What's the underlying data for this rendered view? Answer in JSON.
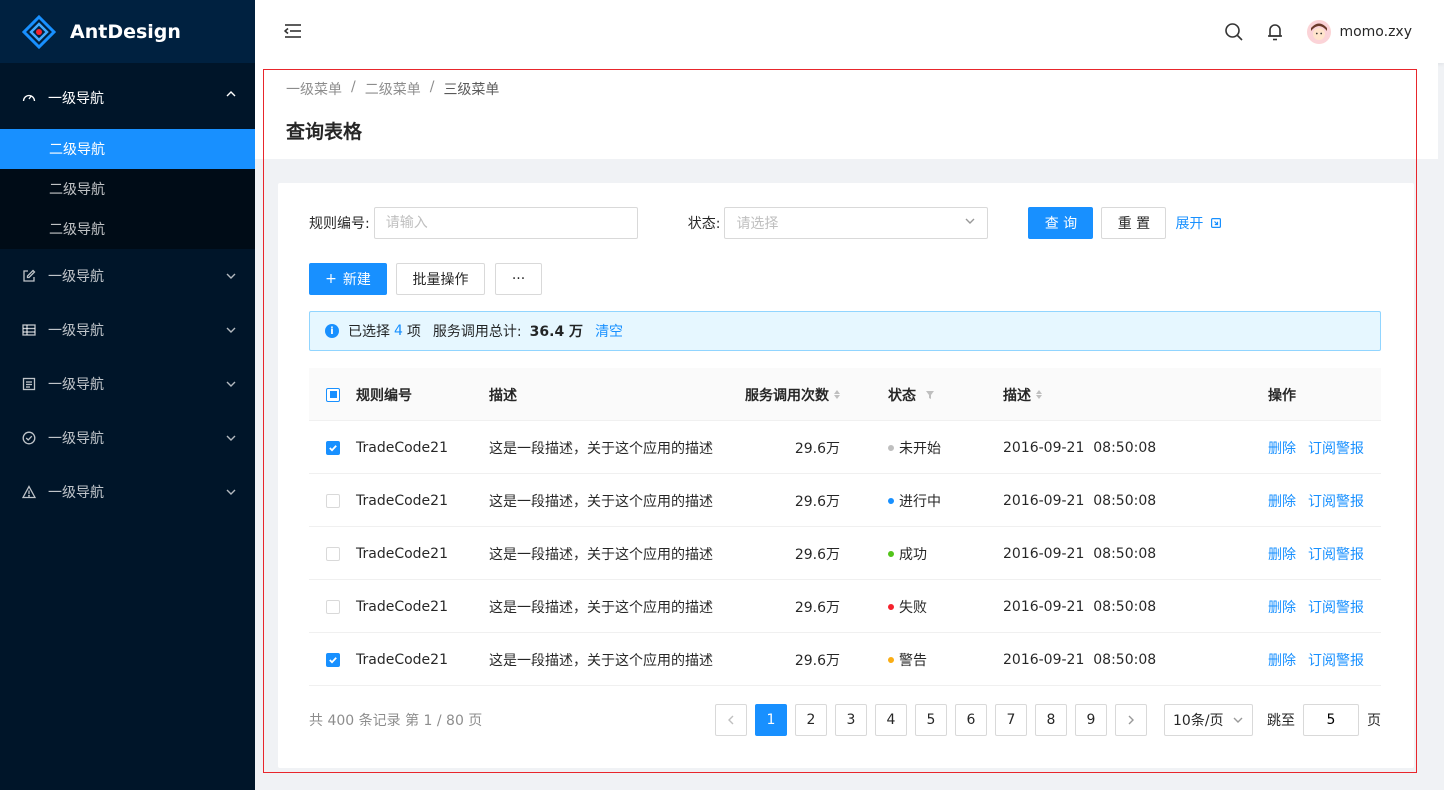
{
  "app": {
    "title": "AntDesign"
  },
  "sidebar": {
    "groups": [
      {
        "label": "一级导航",
        "icon": "dashboard-icon",
        "open": true,
        "children": [
          {
            "label": "二级导航",
            "active": true
          },
          {
            "label": "二级导航",
            "active": false
          },
          {
            "label": "二级导航",
            "active": false
          }
        ]
      },
      {
        "label": "一级导航",
        "icon": "edit-icon",
        "open": false
      },
      {
        "label": "一级导航",
        "icon": "table-icon",
        "open": false
      },
      {
        "label": "一级导航",
        "icon": "profile-icon",
        "open": false
      },
      {
        "label": "一级导航",
        "icon": "check-circle-icon",
        "open": false
      },
      {
        "label": "一级导航",
        "icon": "warning-icon",
        "open": false
      }
    ]
  },
  "header": {
    "user_name": "momo.zxy"
  },
  "breadcrumb": [
    "一级菜单",
    "二级菜单",
    "三级菜单"
  ],
  "page_title": "查询表格",
  "filters": {
    "rule_label": "规则编号:",
    "rule_placeholder": "请输入",
    "status_label": "状态:",
    "status_placeholder": "请选择",
    "query_button": "查 询",
    "reset_button": "重 置",
    "expand_link": "展开"
  },
  "toolbar": {
    "new_button": "新建",
    "batch_button": "批量操作",
    "more_button": "···"
  },
  "alert": {
    "prefix": "已选择",
    "count": "4",
    "unit": "项",
    "total_label": "服务调用总计:",
    "total_value": "36.4 万",
    "clear_link": "清空"
  },
  "table": {
    "columns": {
      "code": "规则编号",
      "desc": "描述",
      "calls": "服务调用次数",
      "status": "状态",
      "time": "描述",
      "op": "操作"
    },
    "rows": [
      {
        "checked": true,
        "code": "TradeCode21",
        "desc": "这是一段描述，关于这个应用的描述",
        "calls": "29.6万",
        "status": "未开始",
        "status_color": "#bfbfbf",
        "time": "2016-09-21  08:50:08",
        "op1": "删除",
        "op2": "订阅警报"
      },
      {
        "checked": false,
        "code": "TradeCode21",
        "desc": "这是一段描述，关于这个应用的描述",
        "calls": "29.6万",
        "status": "进行中",
        "status_color": "#1890ff",
        "time": "2016-09-21  08:50:08",
        "op1": "删除",
        "op2": "订阅警报"
      },
      {
        "checked": false,
        "code": "TradeCode21",
        "desc": "这是一段描述，关于这个应用的描述",
        "calls": "29.6万",
        "status": "成功",
        "status_color": "#52c41a",
        "time": "2016-09-21  08:50:08",
        "op1": "删除",
        "op2": "订阅警报"
      },
      {
        "checked": false,
        "code": "TradeCode21",
        "desc": "这是一段描述，关于这个应用的描述",
        "calls": "29.6万",
        "status": "失败",
        "status_color": "#f5222d",
        "time": "2016-09-21  08:50:08",
        "op1": "删除",
        "op2": "订阅警报"
      },
      {
        "checked": true,
        "code": "TradeCode21",
        "desc": "这是一段描述，关于这个应用的描述",
        "calls": "29.6万",
        "status": "警告",
        "status_color": "#faad14",
        "time": "2016-09-21  08:50:08",
        "op1": "删除",
        "op2": "订阅警报"
      }
    ]
  },
  "pagination": {
    "total_text": "共 400 条记录 第 1 / 80 页",
    "pages": [
      "1",
      "2",
      "3",
      "4",
      "5",
      "6",
      "7",
      "8",
      "9"
    ],
    "current": "1",
    "page_size": "10条/页",
    "jump_label": "跳至",
    "jump_value": "5",
    "jump_suffix": "页"
  },
  "colors": {
    "primary": "#1890ff",
    "sider": "#001529",
    "highlight_frame": "#e8262c"
  }
}
